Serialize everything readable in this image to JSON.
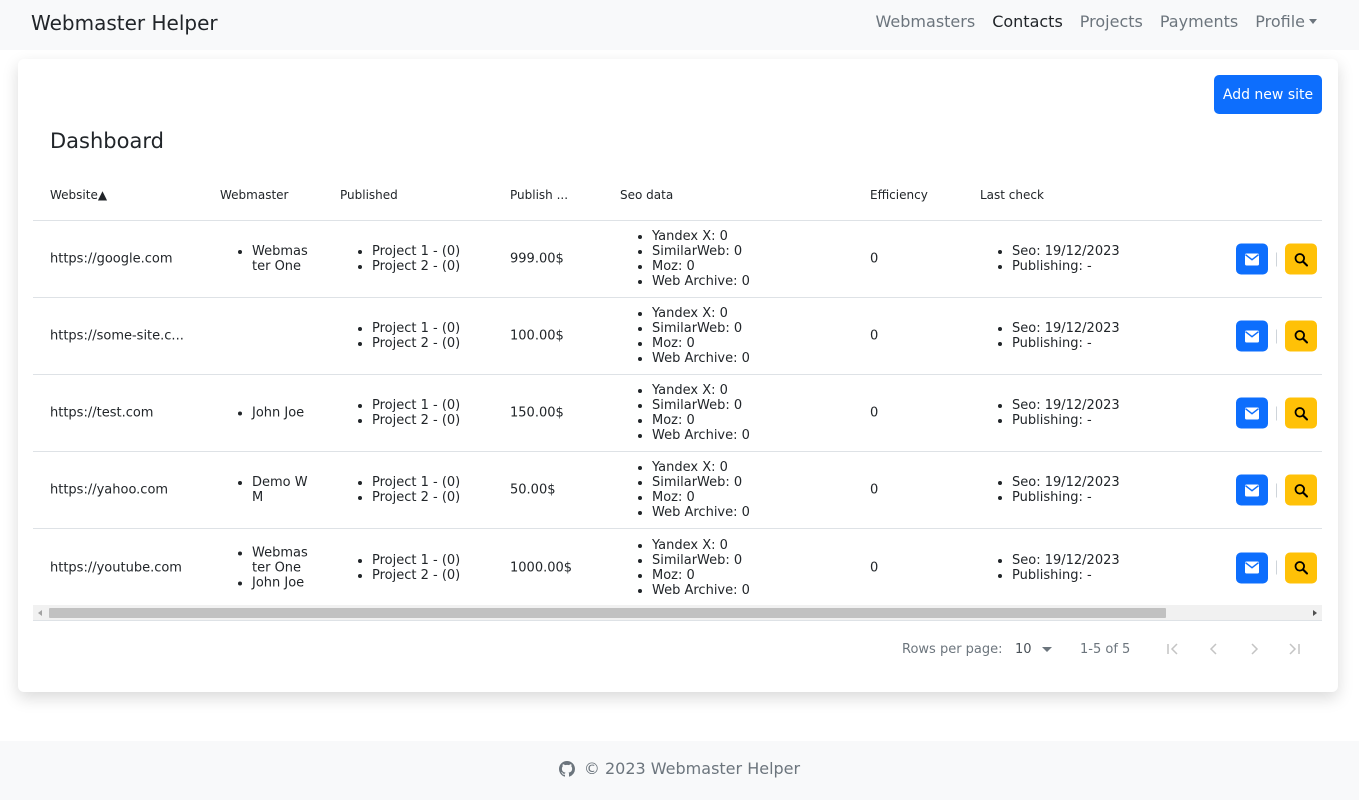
{
  "navbar": {
    "brand": "Webmaster Helper",
    "links": [
      {
        "label": "Webmasters",
        "active": false
      },
      {
        "label": "Contacts",
        "active": true
      },
      {
        "label": "Projects",
        "active": false
      },
      {
        "label": "Payments",
        "active": false
      },
      {
        "label": "Profile",
        "active": false,
        "dropdown": true
      }
    ]
  },
  "dashboard": {
    "add_button": "Add new site",
    "title": "Dashboard",
    "columns": {
      "website": "Website",
      "website_sort_icon": "▲",
      "webmaster": "Webmaster",
      "published": "Published",
      "publish_price": "Publish ...",
      "seo_data": "Seo data",
      "efficiency": "Efficiency",
      "last_check": "Last check"
    },
    "rows": [
      {
        "website": "https://google.com",
        "webmasters": [
          "Webmaster One"
        ],
        "published": [
          "Project 1 - (0)",
          "Project 2 - (0)"
        ],
        "price": "999.00$",
        "seo": [
          "Yandex X: 0",
          "SimilarWeb: 0",
          "Moz: 0",
          "Web Archive: 0"
        ],
        "efficiency": "0",
        "last_check": [
          "Seo: 19/12/2023",
          "Publishing: -"
        ]
      },
      {
        "website": "https://some-site.c...",
        "webmasters": [],
        "published": [
          "Project 1 - (0)",
          "Project 2 - (0)"
        ],
        "price": "100.00$",
        "seo": [
          "Yandex X: 0",
          "SimilarWeb: 0",
          "Moz: 0",
          "Web Archive: 0"
        ],
        "efficiency": "0",
        "last_check": [
          "Seo: 19/12/2023",
          "Publishing: -"
        ]
      },
      {
        "website": "https://test.com",
        "webmasters": [
          "John Joe"
        ],
        "published": [
          "Project 1 - (0)",
          "Project 2 - (0)"
        ],
        "price": "150.00$",
        "seo": [
          "Yandex X: 0",
          "SimilarWeb: 0",
          "Moz: 0",
          "Web Archive: 0"
        ],
        "efficiency": "0",
        "last_check": [
          "Seo: 19/12/2023",
          "Publishing: -"
        ]
      },
      {
        "website": "https://yahoo.com",
        "webmasters": [
          "Demo WM"
        ],
        "published": [
          "Project 1 - (0)",
          "Project 2 - (0)"
        ],
        "price": "50.00$",
        "seo": [
          "Yandex X: 0",
          "SimilarWeb: 0",
          "Moz: 0",
          "Web Archive: 0"
        ],
        "efficiency": "0",
        "last_check": [
          "Seo: 19/12/2023",
          "Publishing: -"
        ]
      },
      {
        "website": "https://youtube.com",
        "webmasters": [
          "Webmaster One",
          "John Joe"
        ],
        "published": [
          "Project 1 - (0)",
          "Project 2 - (0)"
        ],
        "price": "1000.00$",
        "seo": [
          "Yandex X: 0",
          "SimilarWeb: 0",
          "Moz: 0",
          "Web Archive: 0"
        ],
        "efficiency": "0",
        "last_check": [
          "Seo: 19/12/2023",
          "Publishing: -"
        ]
      }
    ],
    "pagination": {
      "rows_per_page_label": "Rows per page:",
      "rows_per_page": "10",
      "range": "1-5 of 5"
    }
  },
  "footer": {
    "text": "© 2023 Webmaster Helper",
    "icon": "github-icon"
  },
  "colors": {
    "primary": "#0d6efd",
    "warning": "#ffc107",
    "navbar_bg": "#f8f9fa",
    "muted": "#6c757d"
  }
}
